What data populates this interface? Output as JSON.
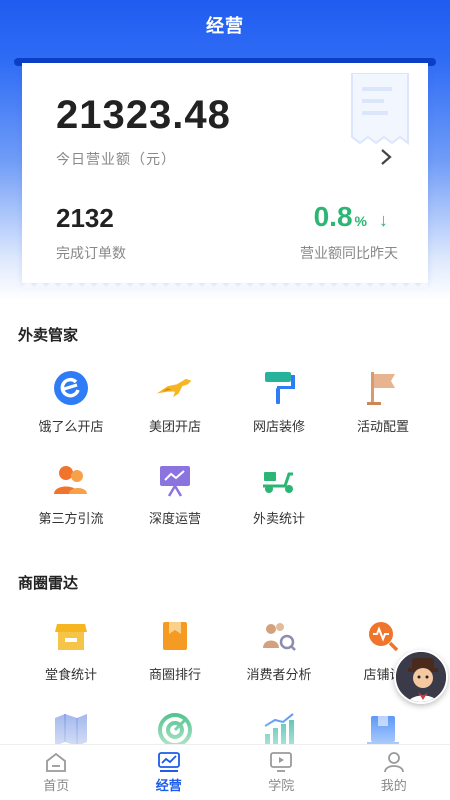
{
  "header": {
    "title": "经营"
  },
  "summary": {
    "amount": "21323.48",
    "amount_label": "今日营业额（元）",
    "orders": "2132",
    "orders_label": "完成订单数",
    "growth_value": "0.8",
    "growth_unit": "%",
    "growth_arrow": "↓",
    "growth_label": "营业额同比昨天"
  },
  "sections": {
    "takeout": {
      "title": "外卖管家",
      "items": [
        {
          "label": "饿了么开店",
          "icon": "eleme-icon"
        },
        {
          "label": "美团开店",
          "icon": "kangaroo-icon"
        },
        {
          "label": "网店装修",
          "icon": "paint-roller-icon"
        },
        {
          "label": "活动配置",
          "icon": "flag-icon"
        },
        {
          "label": "第三方引流",
          "icon": "users-icon"
        },
        {
          "label": "深度运营",
          "icon": "presentation-icon"
        },
        {
          "label": "外卖统计",
          "icon": "scooter-icon"
        }
      ]
    },
    "radar": {
      "title": "商圈雷达",
      "items": [
        {
          "label": "堂食统计",
          "icon": "store-icon"
        },
        {
          "label": "商圈排行",
          "icon": "ranking-icon"
        },
        {
          "label": "消费者分析",
          "icon": "consumer-analysis-icon"
        },
        {
          "label": "店铺诊",
          "icon": "diagnosis-icon"
        }
      ]
    }
  },
  "tabs": [
    {
      "label": "首页",
      "active": false
    },
    {
      "label": "经营",
      "active": true
    },
    {
      "label": "学院",
      "active": false
    },
    {
      "label": "我的",
      "active": false
    }
  ],
  "colors": {
    "primary": "#1d5bea",
    "growth_green": "#2bb673",
    "icon_orange": "#f59a23",
    "icon_blue": "#2e7cf6",
    "icon_teal": "#27b39b"
  }
}
